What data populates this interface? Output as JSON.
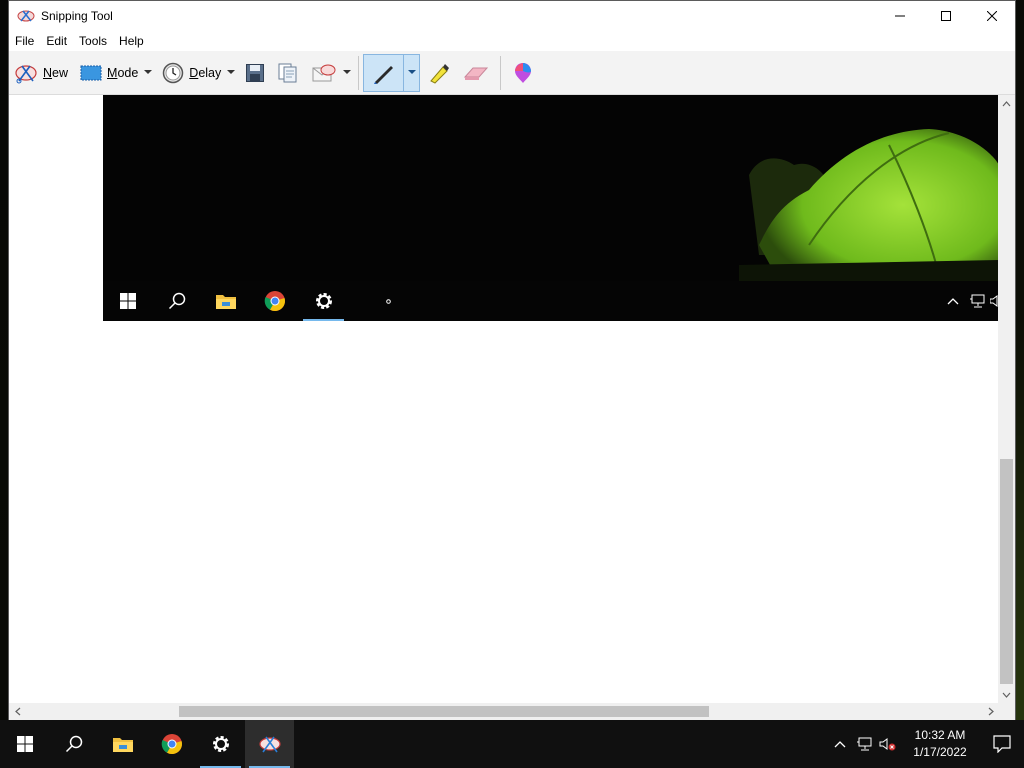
{
  "window": {
    "title": "Snipping Tool",
    "controls": [
      "minimize-icon",
      "maximize-icon",
      "close-icon"
    ]
  },
  "menu": {
    "items": [
      "File",
      "Edit",
      "Tools",
      "Help"
    ]
  },
  "toolbar": {
    "new_label": "New",
    "mode_label": "Mode",
    "delay_label": "Delay",
    "tools": [
      "save-icon",
      "copy-icon",
      "send-icon",
      "pen-icon",
      "highlighter-icon",
      "eraser-icon",
      "paint3d-icon"
    ]
  },
  "captured_snip": {
    "taskbar_icons": [
      "start-icon",
      "search-icon",
      "file-explorer-icon",
      "chrome-icon",
      "settings-icon"
    ],
    "active_icon": "settings-icon",
    "tray_icons": [
      "chevron-up-icon",
      "network-icon",
      "volume-icon"
    ]
  },
  "taskbar": {
    "icons": [
      "start-icon",
      "search-icon",
      "file-explorer-icon",
      "chrome-icon",
      "settings-icon",
      "snipping-tool-icon"
    ],
    "active_icon": "snipping-tool-icon",
    "clock_time": "10:32 AM",
    "clock_date": "1/17/2022",
    "colors": {
      "taskbar_bg": "#101010",
      "accent": "#76b9ed"
    }
  }
}
